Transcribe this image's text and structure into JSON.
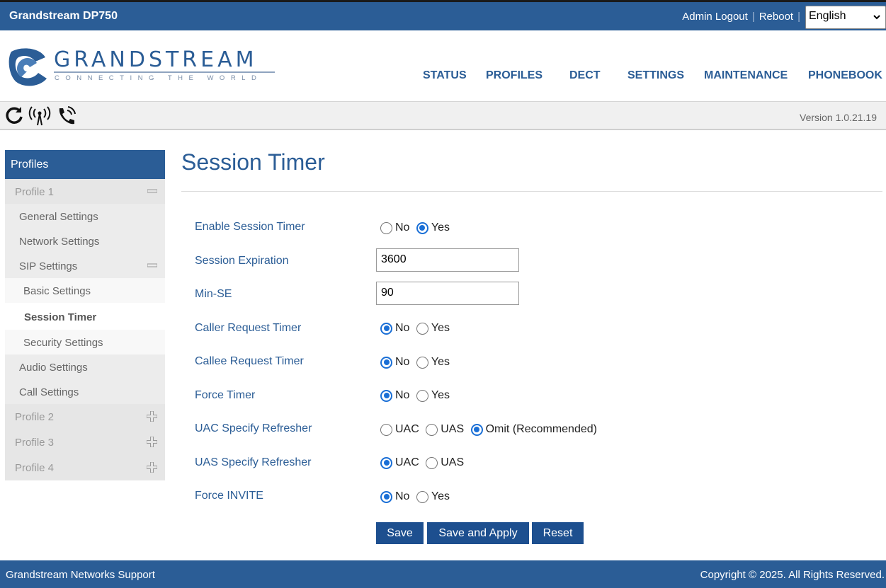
{
  "topbar": {
    "device_title": "Grandstream DP750",
    "admin_logout": "Admin Logout",
    "reboot": "Reboot",
    "separator": "|",
    "language": "English"
  },
  "logo": {
    "word": "GRANDSTREAM",
    "tagline": "CONNECTING THE WORLD"
  },
  "nav": {
    "status": "STATUS",
    "profiles": "PROFILES",
    "dect": "DECT",
    "settings": "SETTINGS",
    "maintenance": "MAINTENANCE",
    "phonebook": "PHONEBOOK"
  },
  "iconbar": {
    "icons": [
      "refresh-icon",
      "antenna-icon",
      "phone-call-icon"
    ],
    "version": "Version 1.0.21.19"
  },
  "sidebar": {
    "title": "Profiles",
    "profile1": "Profile 1",
    "general_settings": "General Settings",
    "network_settings": "Network Settings",
    "sip_settings": "SIP Settings",
    "basic_settings": "Basic Settings",
    "session_timer": "Session Timer",
    "security_settings": "Security Settings",
    "audio_settings": "Audio Settings",
    "call_settings": "Call Settings",
    "profile2": "Profile 2",
    "profile3": "Profile 3",
    "profile4": "Profile 4"
  },
  "main": {
    "title": "Session Timer",
    "fields": {
      "enable_session_timer": {
        "label": "Enable Session Timer",
        "options": [
          "No",
          "Yes"
        ],
        "selected": "Yes"
      },
      "session_expiration": {
        "label": "Session Expiration",
        "value": "3600"
      },
      "min_se": {
        "label": "Min-SE",
        "value": "90"
      },
      "caller_request_timer": {
        "label": "Caller Request Timer",
        "options": [
          "No",
          "Yes"
        ],
        "selected": "No"
      },
      "callee_request_timer": {
        "label": "Callee Request Timer",
        "options": [
          "No",
          "Yes"
        ],
        "selected": "No"
      },
      "force_timer": {
        "label": "Force Timer",
        "options": [
          "No",
          "Yes"
        ],
        "selected": "No"
      },
      "uac_specify_refresher": {
        "label": "UAC Specify Refresher",
        "options": [
          "UAC",
          "UAS",
          "Omit (Recommended)"
        ],
        "selected": "Omit (Recommended)"
      },
      "uas_specify_refresher": {
        "label": "UAS Specify Refresher",
        "options": [
          "UAC",
          "UAS"
        ],
        "selected": "UAC"
      },
      "force_invite": {
        "label": "Force INVITE",
        "options": [
          "No",
          "Yes"
        ],
        "selected": "No"
      }
    },
    "buttons": {
      "save": "Save",
      "save_apply": "Save and Apply",
      "reset": "Reset"
    }
  },
  "footer": {
    "support": "Grandstream Networks Support",
    "copyright": "Copyright © 2025. All Rights Reserved."
  },
  "colors": {
    "brand_blue": "#2b5d96",
    "button_blue": "#1d4f8f",
    "radio_selected": "#1a6fd6"
  }
}
